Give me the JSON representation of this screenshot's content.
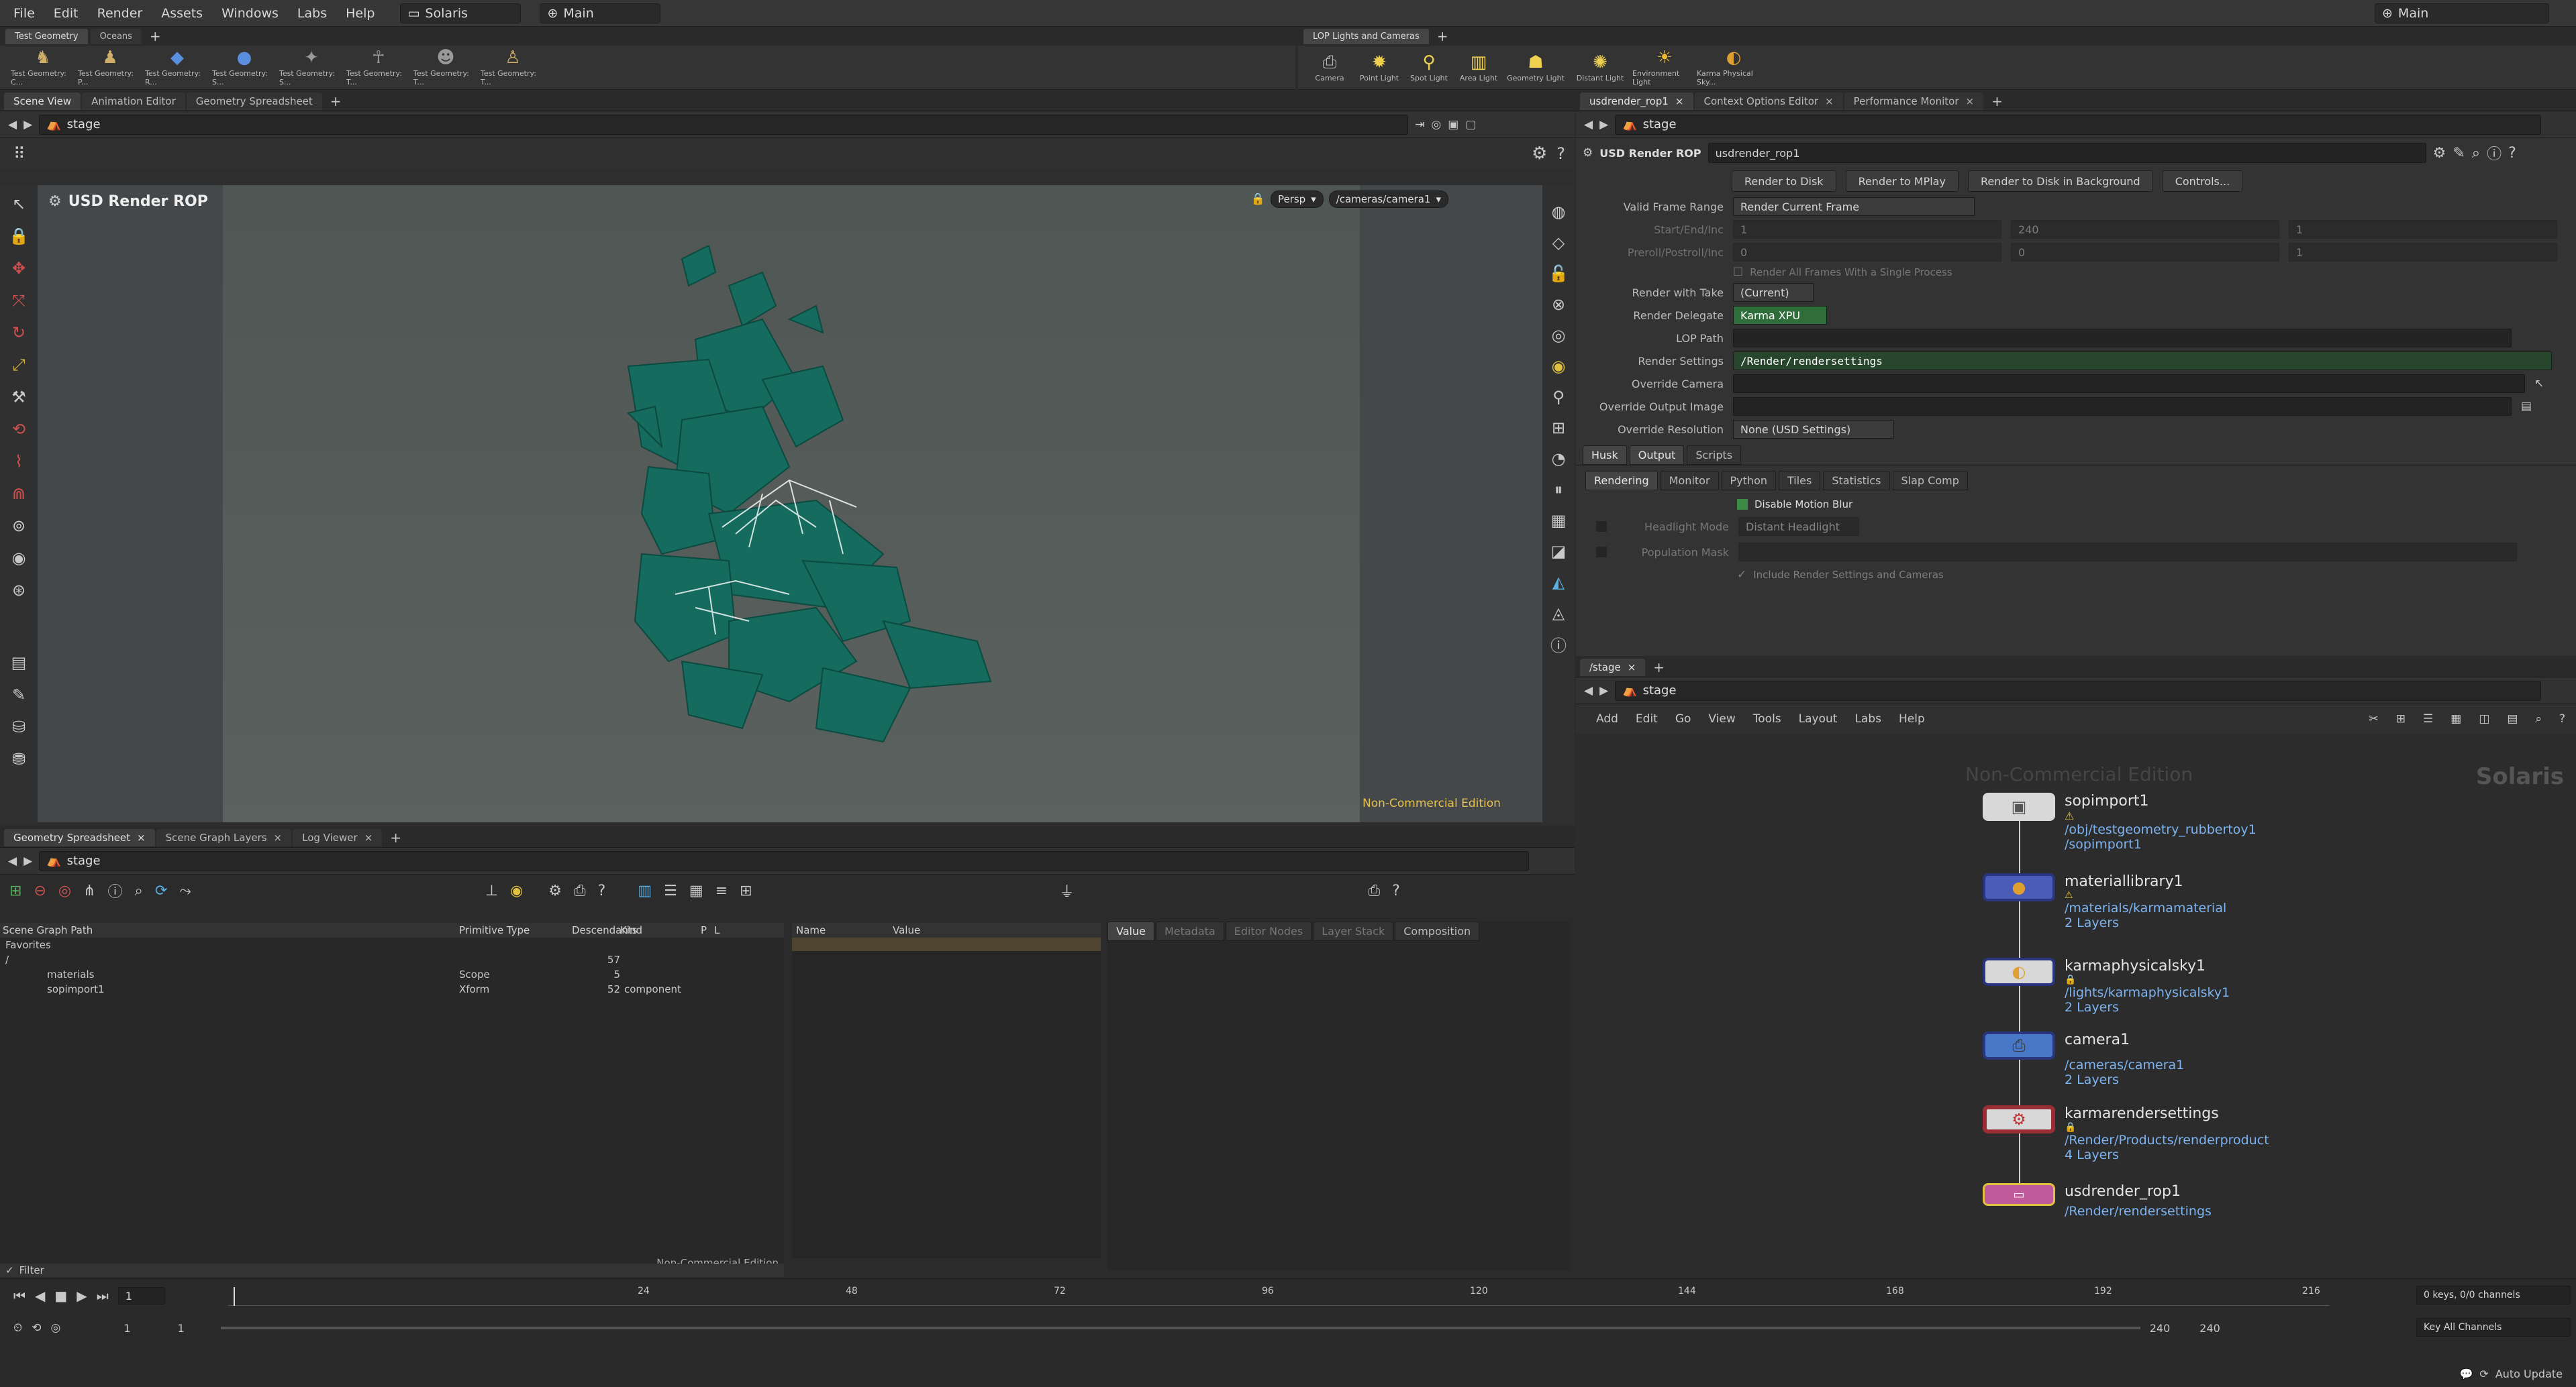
{
  "menu": {
    "items": [
      "File",
      "Edit",
      "Render",
      "Assets",
      "Windows",
      "Labs",
      "Help"
    ],
    "desktop": "Solaris",
    "context": "Main",
    "right_context": "Main"
  },
  "shelf_left": {
    "tabs": [
      "Test Geometry",
      "Oceans"
    ],
    "tools": [
      "Test Geometry: C...",
      "Test Geometry: P...",
      "Test Geometry: R...",
      "Test Geometry: S...",
      "Test Geometry: S...",
      "Test Geometry: T...",
      "Test Geometry: T...",
      "Test Geometry: T..."
    ]
  },
  "shelf_right": {
    "tabs": [
      "LOP Lights and Cameras"
    ],
    "tools": [
      "Camera",
      "Point Light",
      "Spot Light",
      "Area Light",
      "Geometry Light",
      "Distant Light",
      "Environment Light",
      "Karma Physical Sky..."
    ]
  },
  "viewer": {
    "tabs": [
      "Scene View",
      "Animation Editor",
      "Geometry Spreadsheet"
    ],
    "path": "stage",
    "title": "USD Render ROP",
    "persp": "Persp",
    "camera": "/cameras/camera1",
    "watermark": "Non-Commercial Edition"
  },
  "params": {
    "tabs": [
      "usdrender_rop1",
      "Context Options Editor",
      "Performance Monitor"
    ],
    "path": "stage",
    "node_type": "USD Render ROP",
    "node_name": "usdrender_rop1",
    "buttons": [
      "Render to Disk",
      "Render to MPlay",
      "Render to Disk in Background",
      "Controls..."
    ],
    "valid_frame_range_label": "Valid Frame Range",
    "valid_frame_range": "Render Current Frame",
    "start_end_label": "Start/End/Inc",
    "start": "1",
    "end": "240",
    "inc": "1",
    "preroll_label": "Preroll/Postroll/Inc",
    "preroll": "0",
    "postroll": "0",
    "pinc": "1",
    "render_all": "Render All Frames With a Single Process",
    "take_label": "Render with Take",
    "take": "(Current)",
    "delegate_label": "Render Delegate",
    "delegate": "Karma XPU",
    "lop_path_label": "LOP Path",
    "render_settings_label": "Render Settings",
    "render_settings": "/Render/rendersettings",
    "override_camera_label": "Override Camera",
    "override_output_label": "Override Output Image",
    "override_res_label": "Override Resolution",
    "override_res": "None (USD Settings)",
    "main_tabs": [
      "Husk",
      "Output",
      "Scripts"
    ],
    "sub_tabs": [
      "Rendering",
      "Monitor",
      "Python",
      "Tiles",
      "Statistics",
      "Slap Comp"
    ],
    "disable_mb": "Disable Motion Blur",
    "headlight_label": "Headlight Mode",
    "headlight": "Distant Headlight",
    "population_label": "Population Mask",
    "include": "Include Render Settings and Cameras"
  },
  "network": {
    "tab": "/stage",
    "path": "stage",
    "menu": [
      "Add",
      "Edit",
      "Go",
      "View",
      "Tools",
      "Layout",
      "Labs",
      "Help"
    ],
    "watermark": "Non-Commercial Edition",
    "context_label": "Solaris",
    "nodes": [
      {
        "name": "sopimport1",
        "sub": "/obj/testgeometry_rubbertoy1",
        "sub2": "/sopimport1"
      },
      {
        "name": "materiallibrary1",
        "sub": "/materials/karmamaterial",
        "sub2": "2 Layers"
      },
      {
        "name": "karmaphysicalsky1",
        "sub": "/lights/karmaphysicalsky1",
        "sub2": "2 Layers"
      },
      {
        "name": "camera1",
        "sub": "/cameras/camera1",
        "sub2": "2 Layers"
      },
      {
        "name": "karmarendersettings",
        "sub": "/Render/Products/renderproduct",
        "sub2": "4 Layers"
      },
      {
        "name": "usdrender_rop1",
        "sub": "/Render/rendersettings",
        "sub2": ""
      }
    ]
  },
  "spreadsheet": {
    "tabs": [
      "Geometry Spreadsheet",
      "Scene Graph Layers",
      "Log Viewer"
    ],
    "path": "stage",
    "columns": [
      "Scene Graph Path",
      "Primitive Type",
      "Descendants",
      "Kind",
      "P",
      "L"
    ],
    "rows": [
      {
        "path": "Favorites",
        "type": "",
        "desc": "",
        "kind": ""
      },
      {
        "path": "/",
        "type": "",
        "desc": "57",
        "kind": ""
      },
      {
        "path": "materials",
        "type": "Scope",
        "desc": "5",
        "kind": ""
      },
      {
        "path": "sopimport1",
        "type": "Xform",
        "desc": "52",
        "kind": "component"
      }
    ],
    "name_col": "Name",
    "value_col": "Value",
    "detail_tabs": [
      "Value",
      "Metadata",
      "Editor Nodes",
      "Layer Stack",
      "Composition"
    ],
    "filter": "Filter",
    "watermark": "Non-Commercial Edition"
  },
  "timeline": {
    "frame": "1",
    "ticks": [
      "24",
      "48",
      "72",
      "96",
      "120",
      "144",
      "168",
      "192",
      "216"
    ],
    "start": "1",
    "start2": "1",
    "end": "240",
    "end2": "240",
    "keys": "0 keys, 0/0 channels",
    "key_all": "Key All Channels",
    "auto_update": "Auto Update"
  }
}
